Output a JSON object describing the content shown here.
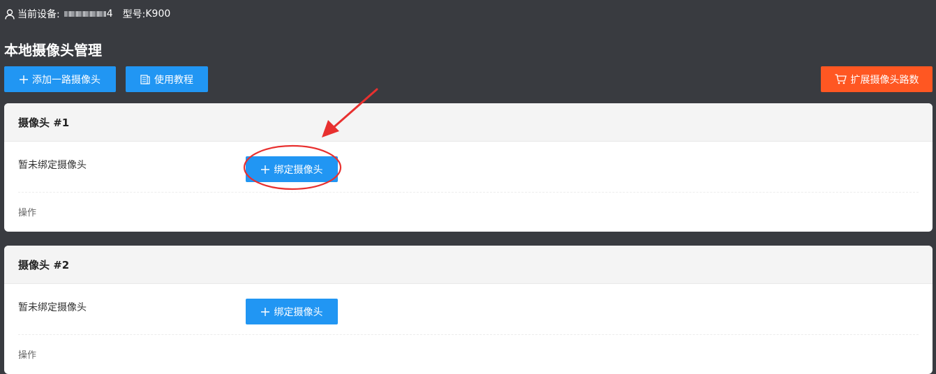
{
  "topbar": {
    "device_label": "当前设备:",
    "device_suffix": "4",
    "model_label": "型号:",
    "model_value": "K900"
  },
  "page": {
    "title": "本地摄像头管理"
  },
  "toolbar": {
    "add_label": "添加一路摄像头",
    "tutorial_label": "使用教程",
    "expand_label": "扩展摄像头路数"
  },
  "cameras": [
    {
      "title": "摄像头 #1",
      "status": "暂未绑定摄像头",
      "bind_label": "绑定摄像头",
      "ops_label": "操作"
    },
    {
      "title": "摄像头 #2",
      "status": "暂未绑定摄像头",
      "bind_label": "绑定摄像头",
      "ops_label": "操作"
    }
  ],
  "colors": {
    "background": "#393b40",
    "primary": "#2196f3",
    "accent": "#ff5722",
    "annotation": "#e8302f"
  },
  "icons": {
    "user": "user-icon",
    "plus": "plus-icon",
    "book": "book-icon",
    "cart": "cart-icon"
  }
}
